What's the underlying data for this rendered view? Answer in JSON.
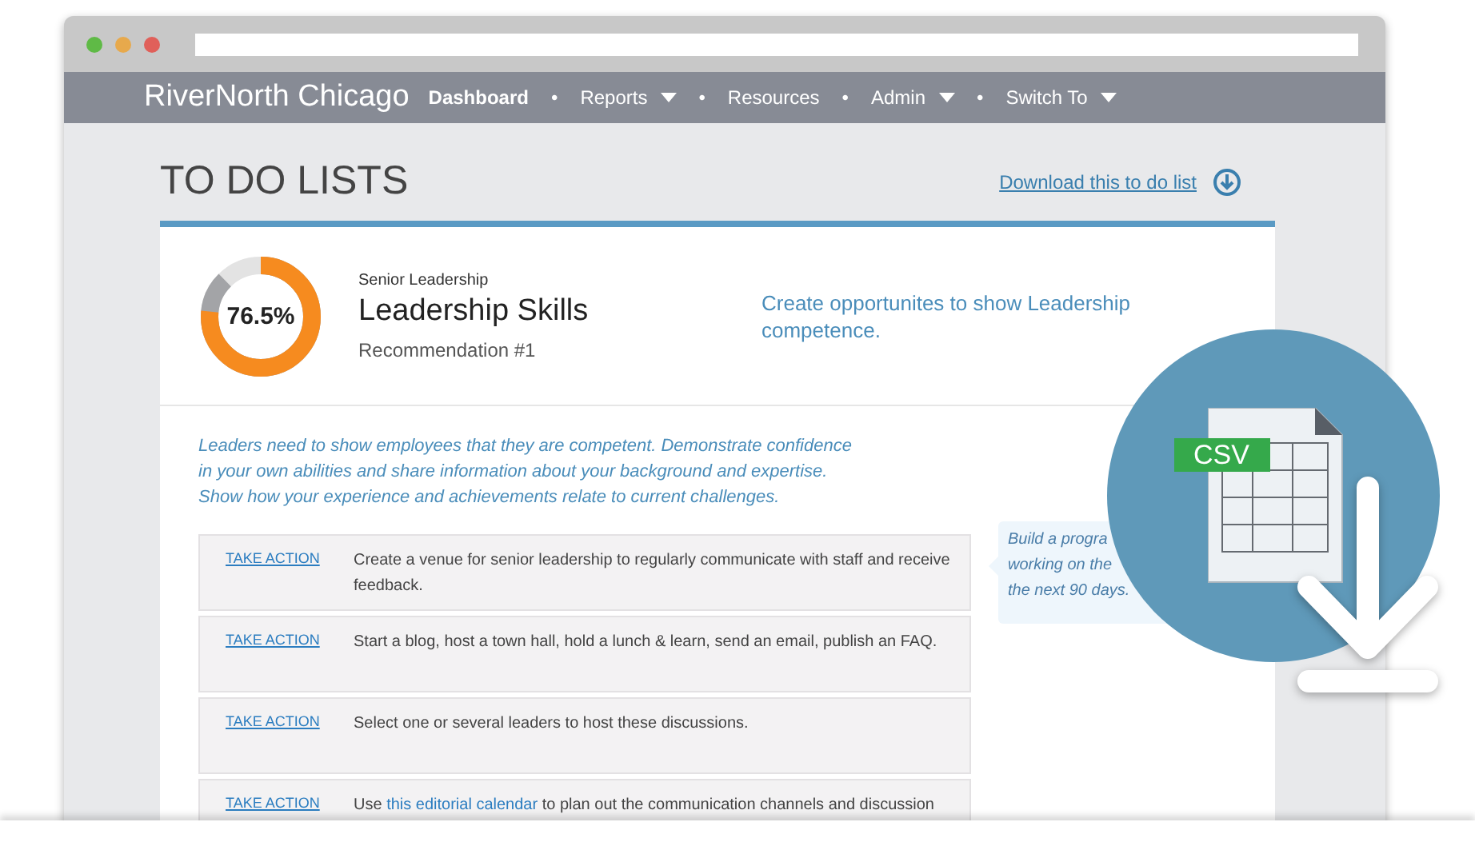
{
  "brand": "RiverNorth Chicago",
  "nav": [
    {
      "label": "Dashboard",
      "selected": true,
      "dropdown": false
    },
    {
      "separator": "•",
      "label": "Reports",
      "selected": false,
      "dropdown": true
    },
    {
      "separator": "•",
      "label": "Resources",
      "selected": false,
      "dropdown": false
    },
    {
      "separator": "•",
      "label": "Admin",
      "selected": false,
      "dropdown": true
    },
    {
      "separator": "•",
      "label": "Switch To",
      "selected": false,
      "dropdown": true
    }
  ],
  "page_title": "TO DO LISTS",
  "download_link": "Download this to do list",
  "recommendation": {
    "percent": "76.5%",
    "category": "Senior Leadership",
    "title": "Leadership Skills",
    "subtitle": "Recommendation #1",
    "goal": "Create opportunites to show Leadership competence."
  },
  "intro": "Leaders need to show employees that they are competent. Demonstrate confidence in your own abilities and share information about your background and expertise. Show how your experience and achievements relate to current challenges.",
  "actions": [
    {
      "link": "TAKE ACTION",
      "before": "Create a venue for senior leadership to regularly communicate with staff and receive feedback."
    },
    {
      "link": "TAKE ACTION",
      "before": "Start a blog, host a town hall, hold a lunch & learn, send an email, publish an FAQ."
    },
    {
      "link": "TAKE ACTION",
      "before": "Select one or several leaders to host these discussions."
    },
    {
      "link": "TAKE ACTION",
      "before": "Use ",
      "inline_link": "this editorial calendar",
      "after": " to plan out the communication channels and discussion"
    }
  ],
  "tip_lines": [
    "Build a progra",
    "working on the",
    "the next 90 days."
  ],
  "csv_badge": "CSV"
}
